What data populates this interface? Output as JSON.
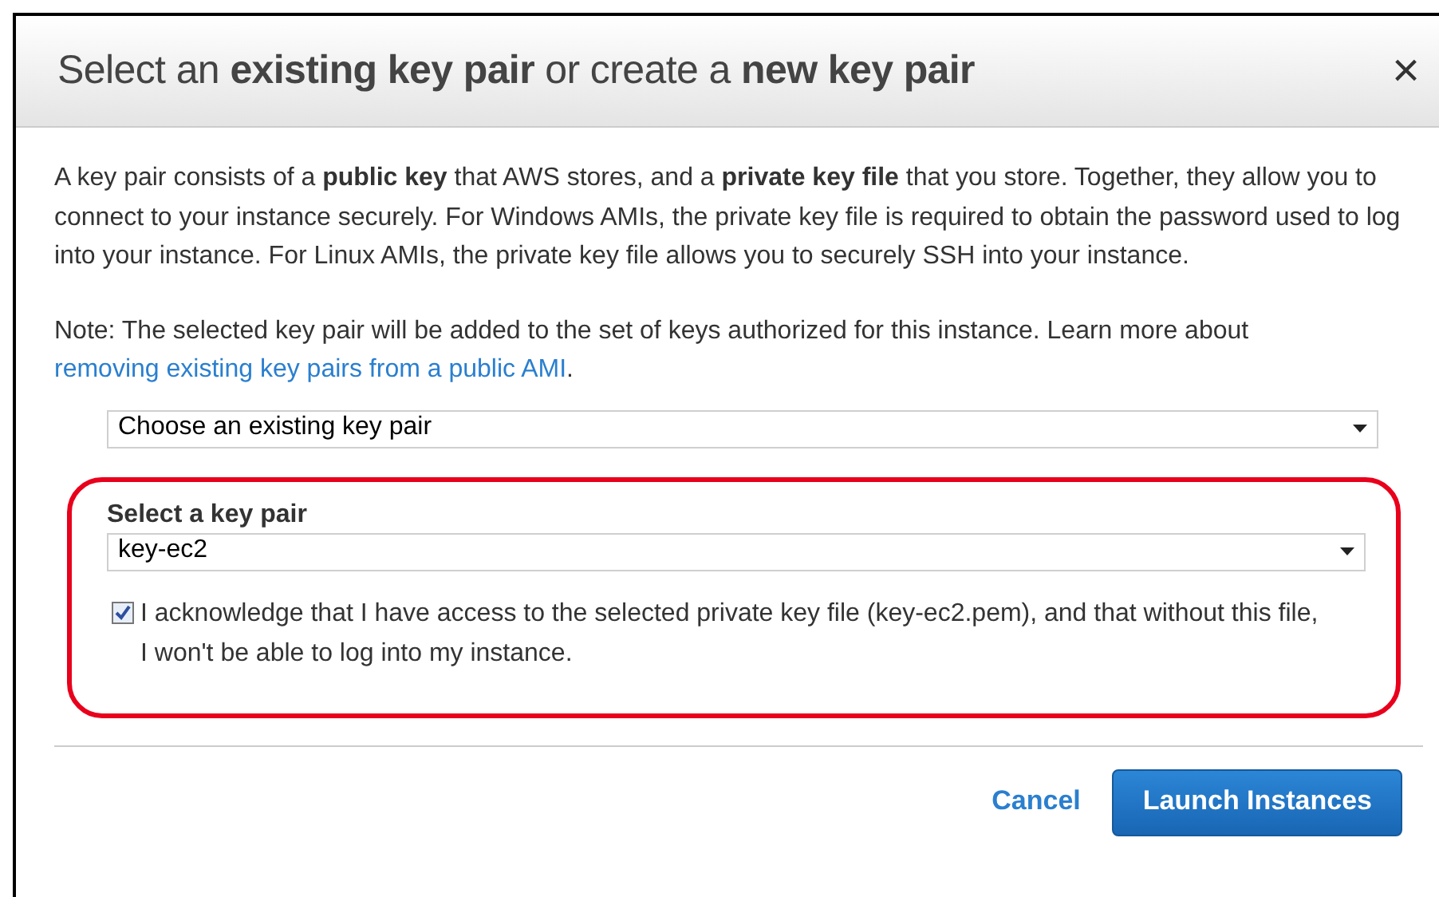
{
  "dialog": {
    "title": "Select an **existing key pair** or create a **new key pair**",
    "close": "×",
    "intro": "A key pair consists of a **public key** that AWS stores, and a **private key file** that you store. Together, they allow you to connect to your instance securely. For Windows AMIs, the private key file is required to obtain the password used to log into your instance. For Linux AMIs, the private key file allows you to securely SSH into your instance.",
    "note": "Note: The selected key pair will be added to the set of keys authorized for this instance. Learn more about",
    "note_link": "removing existing key pairs from a public AMI",
    "note_end": ".",
    "mode_select": {
      "value": "Choose an existing key pair"
    },
    "key_pair": {
      "label": "Select a key pair",
      "value": "key-ec2"
    },
    "acknowledge": {
      "checked": true,
      "text": "I acknowledge that I have access to the selected private key file (key-ec2.pem), and that without this file, I won't be able to log into my instance."
    },
    "buttons": {
      "cancel": "Cancel",
      "launch": "Launch Instances"
    }
  }
}
